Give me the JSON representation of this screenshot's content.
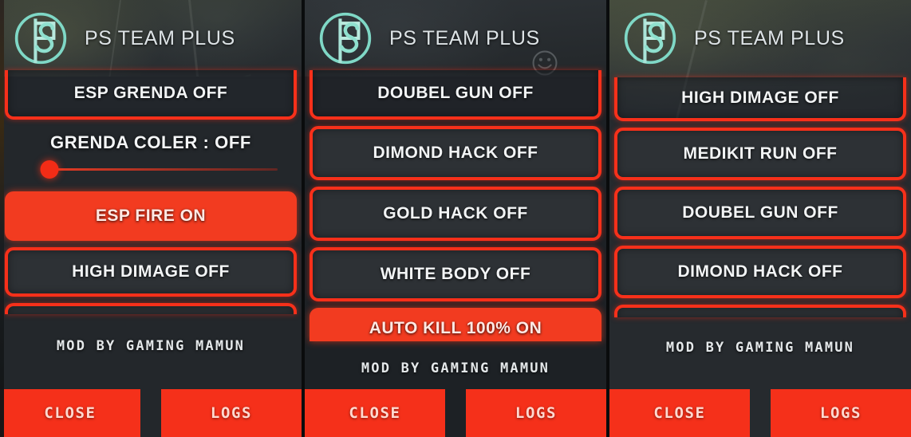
{
  "app": {
    "title": "PS TEAM PLUS",
    "logo_icon": "ps-circle-logo-icon",
    "accent_red": "#F5301A",
    "button_fill": "#2D3135",
    "logo_color": "#7FD8C6",
    "credit": "MOD  BY  GAMING  MAMUN"
  },
  "footer": {
    "close_label": "CLOSE",
    "logs_label": "LOGS"
  },
  "panels": [
    {
      "id": "panel-1",
      "title": "PS TEAM PLUS",
      "partial_top": {
        "label": "ESP GRENDA OFF",
        "state": "OFF"
      },
      "slider": {
        "label": "GRENDA COLER : OFF",
        "value": 0,
        "thumb_color": "#F32C16",
        "track_color": "#F03C23"
      },
      "items": [
        {
          "label": "ESP FIRE ON",
          "state": "ON"
        },
        {
          "label": "HIGH DIMAGE OFF",
          "state": "OFF"
        }
      ],
      "credit": "MOD  BY  GAMING  MAMUN",
      "close_label": "CLOSE",
      "logs_label": "LOGS"
    },
    {
      "id": "panel-2",
      "title": "PS TEAM PLUS",
      "partial_top": {
        "label": "DOUBEL GUN OFF",
        "state": "OFF"
      },
      "items": [
        {
          "label": "DIMOND HACK OFF",
          "state": "OFF"
        },
        {
          "label": "GOLD HACK OFF",
          "state": "OFF"
        },
        {
          "label": "WHITE BODY OFF",
          "state": "OFF"
        },
        {
          "label": "AUTO KILL 100% ON",
          "state": "ON"
        }
      ],
      "credit": "MOD  BY  GAMING  MAMUN",
      "close_label": "CLOSE",
      "logs_label": "LOGS",
      "smiley_icon": "smiley-face-icon"
    },
    {
      "id": "panel-3",
      "title": "PS TEAM PLUS",
      "items": [
        {
          "label": "HIGH DIMAGE OFF",
          "state": "OFF"
        },
        {
          "label": "MEDIKIT RUN OFF",
          "state": "OFF"
        },
        {
          "label": "DOUBEL GUN OFF",
          "state": "OFF"
        },
        {
          "label": "DIMOND HACK OFF",
          "state": "OFF"
        }
      ],
      "credit": "MOD  BY  GAMING  MAMUN",
      "close_label": "CLOSE",
      "logs_label": "LOGS"
    }
  ]
}
